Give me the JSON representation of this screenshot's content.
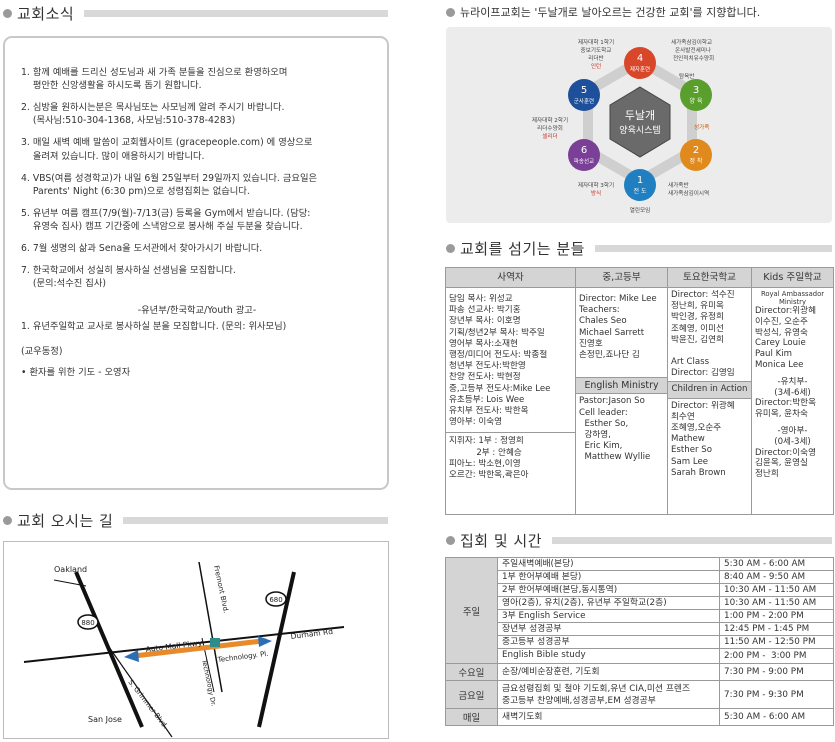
{
  "sections": {
    "news": "교회소식",
    "map": "교회 오시는 길",
    "staff": "교회를 섬기는 분들",
    "schedule": "집회 및 시간",
    "vision": "뉴라이프교회는 '두날개로 날아오르는 건강한 교회'를 지향합니다."
  },
  "notices": [
    "1. 함께 예배를 드리신 성도님과 새 가족 분들을 진심으로 환영하오며\n    평안한 신앙생활을 하시도록 돕기 원합니다.",
    "2. 심방을 원하시는분은 목사님또는 사모님께 알려 주시기 바랍니다.\n    (목사님:510-304-1368, 사모님:510-378-4283)",
    "3. 매일 새벽 예배 말씀이 교회웹사이트 (gracepeople.com) 에 영상으로\n    올려져 있습니다. 많이 애용하시기 바랍니다.",
    "4. VBS(여름 성경학교)가 내일 6월 25일부터 29일까지 있습니다. 금요일은\n    Parents' Night (6:30 pm)으로 성령집회는 없습니다.",
    "5. 유년부 여름 캠프(7/9(월)-7/13(금) 등록을 Gym에서 받습니다. (담당:\n    유영숙 집사) 캠프 기간중에 스낵암으로 봉사해 주실 두분을 찾습니다.",
    "6. 7월 생명의 삶과 Sena을 도서관에서 찾아가시기 바랍니다.",
    "7. 한국학교에서 성실히 봉사하실 선생님을 모집합니다.\n    (문의:석수진 집사)"
  ],
  "youth_ad": {
    "title": "-유년부/한국학교/Youth 광고-",
    "item": "1. 유년주일학교 교사로 봉사하실 분을 모집합니다. (문의: 위사모님)"
  },
  "prayer": {
    "title": "(교우동정)",
    "item": "• 환자를 위한 기도 - 오영자"
  },
  "diagram": {
    "center_line1": "두날개",
    "center_line2": "양육시스템",
    "n1": "1",
    "l1": "전 도",
    "n2": "2",
    "l2": "정 착",
    "n3": "3",
    "l3": "양 육",
    "n4": "4",
    "l4": "제자훈련",
    "n5": "5",
    "l5": "군사훈련",
    "n6": "6",
    "l6": "파송선교",
    "t1": "열린모임",
    "t2a": "새가족반",
    "t2b": "새가족삼김이시역",
    "t3": "성가족",
    "t4a": "세가족삼김이학교",
    "t4b": "온사발전세미나",
    "t4c": "전인적치유수양회",
    "t4d": "탐육반",
    "t5a": "제자대학 1학기",
    "t5b": "중보기도학교",
    "t5c": "리더반",
    "t5d": "인턴",
    "t6a": "제자대학 2학기",
    "t6b": "리더수양회",
    "t6c": "셀리더",
    "t7a": "제자대학 3학기",
    "t7b": "방식"
  },
  "staff": {
    "headers": [
      "사역자",
      "중,고등부",
      "토요한국학교",
      "Kids 주일학교"
    ],
    "col1": [
      "담임 목사: 위성교",
      "파송 선교사: 박기홍",
      "장년부 목사: 이호명",
      "기획/청년2부 목사: 박주일",
      "영어부 목사:소재현",
      "행정/미디어 전도사: 박종철",
      "청년부 전도사:박한영",
      "찬양 전도사: 박현정",
      "중,고등부 전도사:Mike Lee",
      "유초등부: Lois Wee",
      "유치부 전도사: 박한옥",
      "영아부: 이숙영"
    ],
    "col1_bottom": [
      "지휘자: 1부 : 정영희",
      "          2부 : 안혜승",
      "피아노: 박소현,이영",
      "오르간: 박한옥,곽은아"
    ],
    "col2": [
      "Director: Mike Lee",
      "Teachers:",
      " Chales Seo",
      " Michael Sarrett",
      " 진영호",
      " 손정민,죠나단 김"
    ],
    "col2_sub": "English Ministry",
    "col2_bottom": [
      "Pastor:Jason So",
      "Cell leader:",
      "  Esther So,",
      "  강하영,",
      "  Eric Kim,",
      "  Matthew Wyllie"
    ],
    "col3": [
      "Director: 석수진",
      "정난희, 유미옥",
      "박인경, 유정희",
      "조혜영, 이미선",
      "박윤진, 김연희",
      "",
      "Art Class",
      "Director: 김영임"
    ],
    "col3_sub": "Children in Action",
    "col3_bottom": [
      "Director: 위광혜",
      "최수연",
      "조혜영,오순주",
      "Mathew",
      "Esther So",
      "Sam Lee",
      "Sarah Brown"
    ],
    "col4": [
      "Royal Ambassador",
      "Ministry",
      "Director:위광혜",
      "이수진, 오순주",
      "박성식, 유영숙",
      "Carey Louie",
      "Paul Kim",
      "Monica Lee",
      "",
      "-유치부-",
      "(3세-6세)",
      "Director:박한옥",
      "유미옥, 윤차숙",
      "",
      "-영아부-",
      "(0세-3세)",
      "Director:이숙영",
      "김윤옥, 윤영실",
      "정난희"
    ]
  },
  "schedule": {
    "sunday_label": "주일",
    "sunday": [
      {
        "name": "주일새벽예배(본당)",
        "time": "5:30 AM - 6:00 AM"
      },
      {
        "name": "1부 한어부예배 본당)",
        "time": "8:40 AM - 9:50 AM"
      },
      {
        "name": "2부 한어부예배(본당,동시통역)",
        "time": "10:30 AM - 11:50 AM"
      },
      {
        "name": "영아(2층), 유치(2층), 유년부 주일학교(2층)",
        "time": "10:30 AM - 11:50 AM"
      },
      {
        "name": "3부 English Service",
        "time": "1:00 PM - 2:00 PM"
      },
      {
        "name": "장년부 성경공부",
        "time": "12:45 PM - 1:45 PM"
      },
      {
        "name": "중고등부 성경공부",
        "time": "11:50 AM - 12:50 PM"
      },
      {
        "name": "English Bible study",
        "time": "2:00 PM -  3:00 PM"
      }
    ],
    "wed_label": "수요일",
    "wed": {
      "name": "순장/예비순장훈련, 기도회",
      "time": "7:30 PM - 9:00 PM"
    },
    "fri_label": "금요일",
    "fri": {
      "name1": "금요성령집회 및 철야 기도회,유년 CIA,미션 프렌즈",
      "name2": "중고등부 찬양예배,성경공부,EM 성경공부",
      "time": "7:30 PM - 9:30 PM"
    },
    "daily_label": "매일",
    "daily": {
      "name": "새벽기도회",
      "time": "5:30 AM - 6:00 AM"
    }
  },
  "map": {
    "oakland": "Oakland",
    "sanjose": "San Jose",
    "fremont": "Fremont Blvd.",
    "automall": "Auto Mall Pkwy",
    "durham": "Durham Rd",
    "technology": "Technology Dr.",
    "technology_pl": "Technology. Pl.",
    "grimmer": "S. Grimmer Blvd.",
    "hwy880": "880",
    "hwy680": "680"
  }
}
